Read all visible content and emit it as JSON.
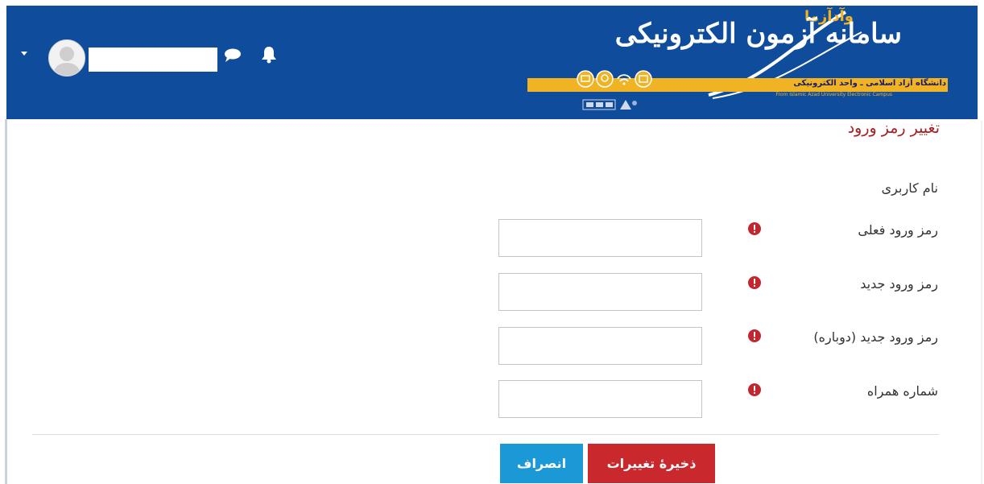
{
  "brand": {
    "small_title": "وآدآزما",
    "title": "سامانه آزمون الکترونیکی",
    "tagline": "دانشگاه آزاد اسلامی ـ واحد الکترونیکی",
    "subtitle": "From Islamic Azad University Electronic Campus"
  },
  "colors": {
    "navbar": "#0f4c9c",
    "accent": "#f0b323",
    "title": "#a61e22",
    "save": "#c9282d",
    "cancel": "#1b98d6",
    "required": "#c1272d"
  },
  "header": {
    "menu_caret_icon": "caret-down-icon",
    "messages_icon": "chat-icon",
    "notifications_icon": "bell-icon"
  },
  "page": {
    "title": "تغییر رمز ورود"
  },
  "form": {
    "username_label": "نام کاربری",
    "current_password_label": "رمز ورود فعلی",
    "new_password_label": "رمز ورود جدید",
    "new_password_again_label": "رمز ورود جدید (دوباره)",
    "mobile_label": "شماره همراه",
    "current_password_value": "",
    "new_password_value": "",
    "new_password_again_value": "",
    "mobile_value": ""
  },
  "actions": {
    "save_label": "ذخیرهٔ تغییرات",
    "cancel_label": "انصراف"
  }
}
